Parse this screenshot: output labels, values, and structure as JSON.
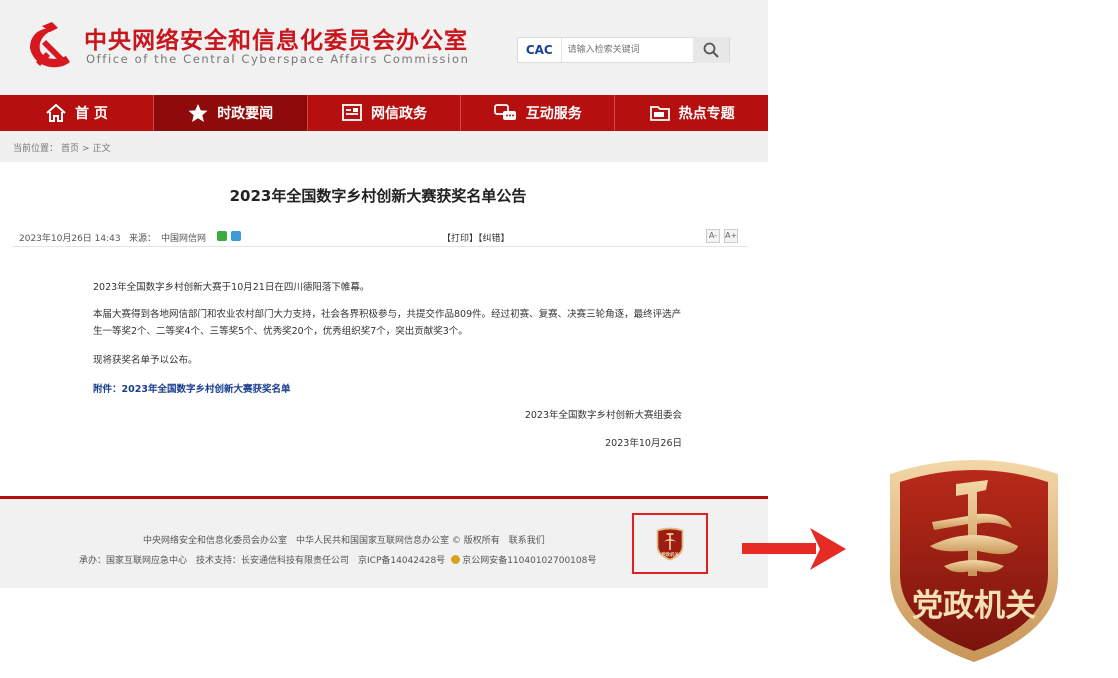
{
  "header": {
    "title": "中央网络安全和信息化委员会办公室",
    "subtitle": "Office of the Central Cyberspace Affairs Commission",
    "search_logo": "CAC",
    "search_placeholder": "请输入检索关键词",
    "search_icon": "search-icon"
  },
  "nav": {
    "items": [
      {
        "label": "首 页",
        "icon": "home-icon"
      },
      {
        "label": "时政要闻",
        "icon": "star-icon"
      },
      {
        "label": "网信政务",
        "icon": "document-icon"
      },
      {
        "label": "互动服务",
        "icon": "chat-icon"
      },
      {
        "label": "热点专题",
        "icon": "folder-icon"
      }
    ]
  },
  "breadcrumb": {
    "label": "当前位置：",
    "home": "首页",
    "separator": ">",
    "current": "正文"
  },
  "article": {
    "title": "2023年全国数字乡村创新大赛获奖名单公告",
    "date": "2023年10月26日 14:43",
    "source_label": "来源：",
    "source": "中国网信网",
    "tools": "【打印】【纠错】",
    "font_smaller": "A-",
    "font_larger": "A+",
    "paragraphs": [
      "2023年全国数字乡村创新大赛于10月21日在四川德阳落下帷幕。",
      "本届大赛得到各地网信部门和农业农村部门大力支持，社会各界积极参与，共提交作品809件。经过初赛、复赛、决赛三轮角逐，最终评选产生一等奖2个、二等奖4个、三等奖5个、优秀奖20个，优秀组织奖7个，突出贡献奖3个。",
      "现将获奖名单予以公布。"
    ],
    "attachment": "附件：2023年全国数字乡村创新大赛获奖名单",
    "signature": "2023年全国数字乡村创新大赛组委会",
    "sign_date": "2023年10月26日"
  },
  "footer": {
    "line1": "中央网络安全和信息化委员会办公室　中华人民共和国国家互联网信息办公室 © 版权所有　联系我们",
    "line2_a": "承办：国家互联网应急中心　技术支持：长安通信科技有限责任公司　京ICP备14042428号",
    "line2_b": "京公网安备11040102700108号",
    "badge_text": "党政机关"
  },
  "callout": {
    "badge_text": "党政机关"
  },
  "colors": {
    "brand_red": "#b5100f",
    "title_red": "#c8161d",
    "link_blue": "#1a3d8f",
    "badge_gold": "#e9c99a",
    "badge_dark": "#9c1b12"
  }
}
